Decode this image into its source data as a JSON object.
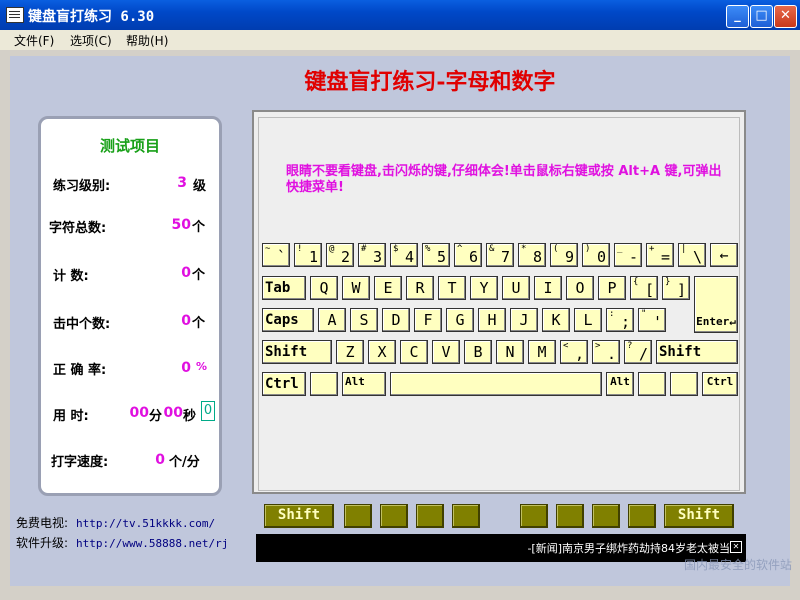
{
  "window": {
    "title": "键盘盲打练习  6.30"
  },
  "menu": [
    "文件(F)",
    "选项(C)",
    "帮助(H)"
  ],
  "heading": "键盘盲打练习-字母和数字",
  "stats": {
    "title": "测试项目",
    "level_label": "练习级别:",
    "level_value": "3",
    "level_unit": "级",
    "total_label": "字符总数:",
    "total_value": "50",
    "total_unit": "个",
    "count_label": "计    数:",
    "count_value": "0",
    "count_unit": "个",
    "hit_label": "击中个数:",
    "hit_value": "0",
    "hit_unit": "个",
    "rate_label": "正 确 率:",
    "rate_value": "0",
    "rate_unit": "%",
    "time_label": "用    时:",
    "time_min": "00",
    "time_min_unit": "分",
    "time_sec": "00",
    "time_sec_unit": "秒",
    "time_extra": "0",
    "speed_label": "打字速度:",
    "speed_value": "0",
    "speed_unit": "个/分"
  },
  "tip": "眼睛不要看键盘,击闪烁的键,仔细体会!单击鼠标右键或按 Alt+A 键,可弹出快捷菜单!",
  "keys": {
    "row1": [
      {
        "sub": "~",
        "main": "`"
      },
      {
        "sub": "!",
        "main": "1"
      },
      {
        "sub": "@",
        "main": "2"
      },
      {
        "sub": "#",
        "main": "3"
      },
      {
        "sub": "$",
        "main": "4"
      },
      {
        "sub": "%",
        "main": "5"
      },
      {
        "sub": "^",
        "main": "6"
      },
      {
        "sub": "&",
        "main": "7"
      },
      {
        "sub": "*",
        "main": "8"
      },
      {
        "sub": "(",
        "main": "9"
      },
      {
        "sub": ")",
        "main": "0"
      },
      {
        "sub": "_",
        "main": "-"
      },
      {
        "sub": "+",
        "main": "="
      },
      {
        "sub": "|",
        "main": "\\"
      }
    ],
    "backspace": "←",
    "tab": "Tab",
    "row2": [
      "Q",
      "W",
      "E",
      "R",
      "T",
      "Y",
      "U",
      "I",
      "O",
      "P"
    ],
    "row2_br": [
      {
        "sub": "{",
        "main": "["
      },
      {
        "sub": "}",
        "main": "]"
      }
    ],
    "caps": "Caps",
    "row3": [
      "A",
      "S",
      "D",
      "F",
      "G",
      "H",
      "J",
      "K",
      "L"
    ],
    "row3_p": [
      {
        "sub": ":",
        "main": ";"
      },
      {
        "sub": "\"",
        "main": "'"
      }
    ],
    "enter": "Enter↵",
    "lshift": "Shift",
    "row4": [
      "Z",
      "X",
      "C",
      "V",
      "B",
      "N",
      "M"
    ],
    "row4_p": [
      {
        "sub": "<",
        "main": ","
      },
      {
        "sub": ">",
        "main": "."
      },
      {
        "sub": "?",
        "main": "/"
      }
    ],
    "rshift": "Shift",
    "lctrl": "Ctrl",
    "lalt": "Alt",
    "ralt": "Alt",
    "rctrl": "Ctrl"
  },
  "fingers": {
    "left_shift": "Shift",
    "right_shift": "Shift"
  },
  "links": {
    "tv_label": "免费电视:",
    "tv_url": "http://tv.51kkkk.com/",
    "upgrade_label": "软件升级:",
    "upgrade_url": "http://www.58888.net/rj"
  },
  "news": "-[新闻]南京男子绑炸药劫持84岁老太被当",
  "watermark": "国内最安全的软件站",
  "colors": {
    "title_bar": "#0048c8",
    "heading": "#e00000",
    "value": "#e010e0",
    "key_face": "#ffffc0",
    "finger_key": "#808000"
  }
}
